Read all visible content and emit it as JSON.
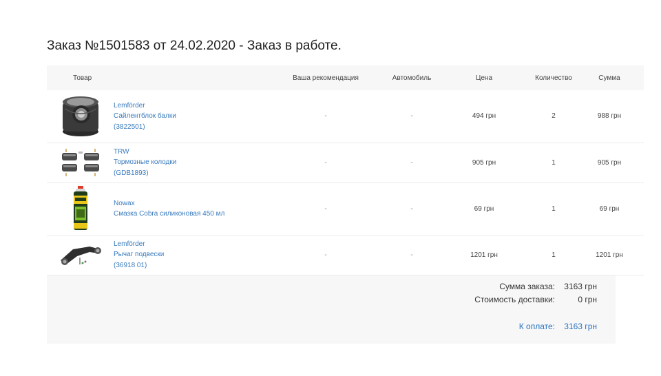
{
  "order": {
    "title": "Заказ №1501583 от 24.02.2020 - Заказ в работе."
  },
  "table": {
    "headers": {
      "product": "Товар",
      "recommendation": "Ваша рекомендация",
      "car": "Автомобиль",
      "price": "Цена",
      "quantity": "Количество",
      "sum": "Сумма"
    },
    "rows": [
      {
        "brand": "Lemförder",
        "name": "Сайлентблок балки",
        "code": "(3822501)",
        "recommendation": "-",
        "car": "-",
        "price": "494 грн",
        "quantity": "2",
        "sum": "988 грн",
        "icon": "silent-block-icon"
      },
      {
        "brand": "TRW",
        "name": "Тормозные колодки",
        "code": "(GDB1893)",
        "recommendation": "-",
        "car": "-",
        "price": "905 грн",
        "quantity": "1",
        "sum": "905 грн",
        "icon": "brake-pads-icon"
      },
      {
        "brand": "Nowax",
        "name": "Смазка Cobra силиконовая 450 мл",
        "code": "",
        "recommendation": "-",
        "car": "-",
        "price": "69 грн",
        "quantity": "1",
        "sum": "69 грн",
        "icon": "spray-can-icon"
      },
      {
        "brand": "Lemförder",
        "name": "Рычаг подвески",
        "code": "(36918 01)",
        "recommendation": "-",
        "car": "-",
        "price": "1201 грн",
        "quantity": "1",
        "sum": "1201 грн",
        "icon": "control-arm-icon"
      }
    ]
  },
  "totals": {
    "order_sum_label": "Сумма заказа:",
    "order_sum_value": "3163 грн",
    "delivery_label": "Стоимость доставки:",
    "delivery_value": "0 грн",
    "pay_label": "К оплате:",
    "pay_value": "3163 грн"
  },
  "colors": {
    "link": "#3a7bbd",
    "pay": "#2b73c0",
    "panel_bg": "#f7f7f7"
  }
}
